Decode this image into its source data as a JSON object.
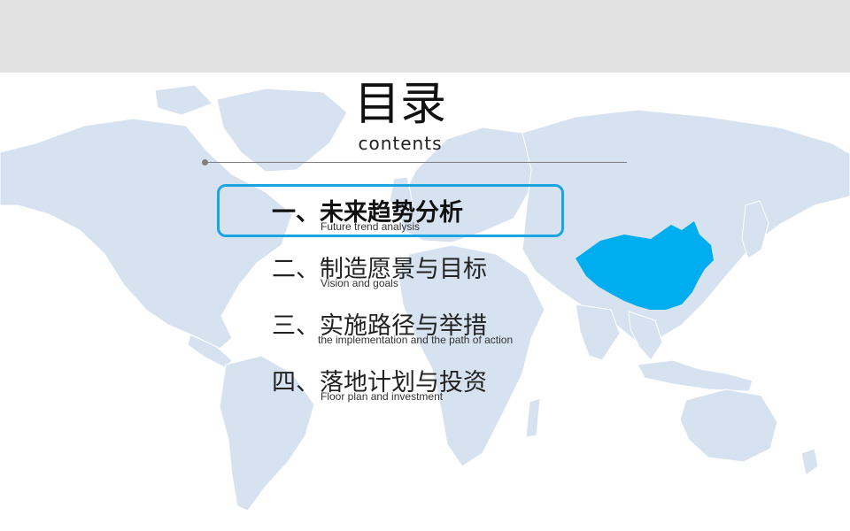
{
  "slide": {
    "title": "目录",
    "subtitle": "contents",
    "items": [
      {
        "label": "一、未来趋势分析",
        "sublabel": "Future trend analysis",
        "active": true
      },
      {
        "label": "二、制造愿景与目标",
        "sublabel": "Vision and goals",
        "active": false
      },
      {
        "label": "三、实施路径与举措",
        "sublabel": "the implementation and the path of action",
        "active": false
      },
      {
        "label": "四、落地计划与投资",
        "sublabel": "Floor plan and investment",
        "active": false
      }
    ]
  },
  "colors": {
    "map_land": "#d7e2f0",
    "china_highlight": "#00aeef",
    "highlight_border": "#1aa4e2",
    "top_bar": "#e1e1e1"
  },
  "icons": [
    "world-map",
    "china-map-highlight"
  ]
}
